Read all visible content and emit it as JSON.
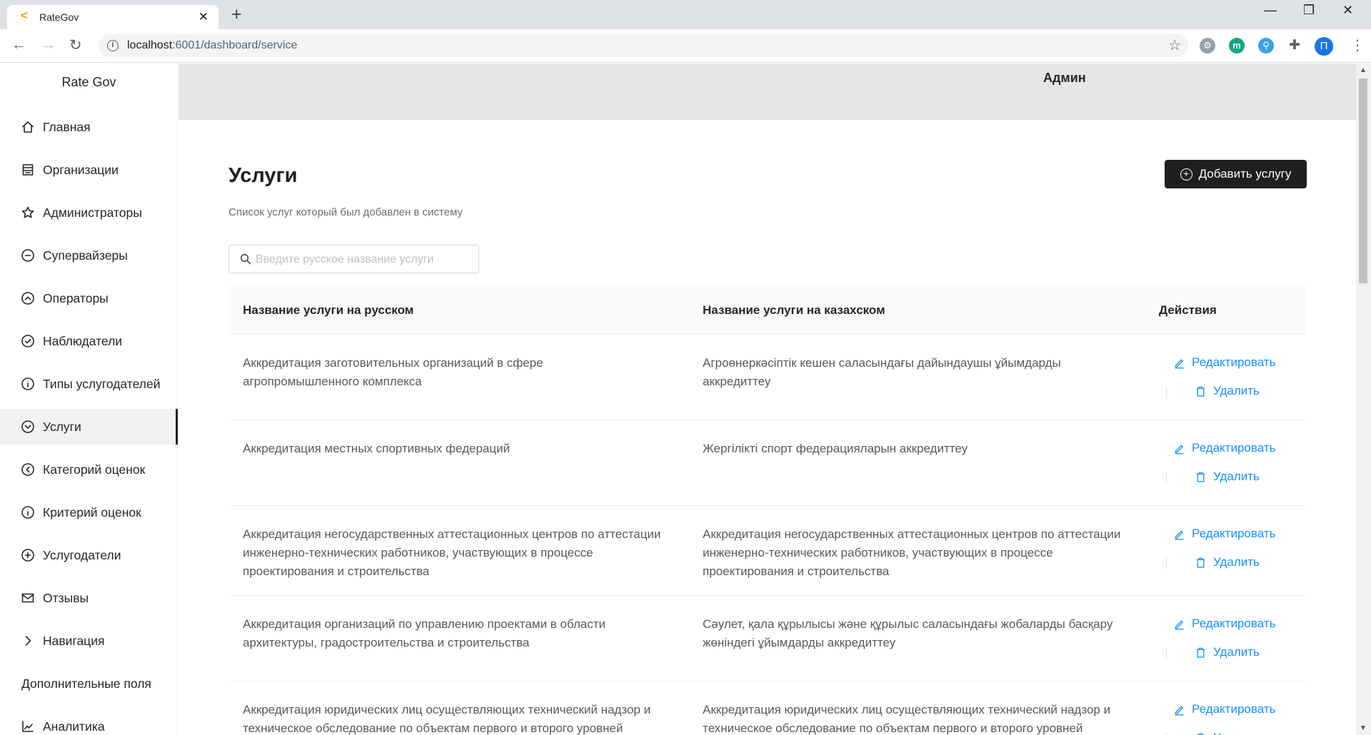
{
  "browser": {
    "tab_title": "RateGov",
    "url_host": "localhost",
    "url_rest": ":6001/dashboard/service",
    "profile_initial": "П"
  },
  "app": {
    "brand": "Rate Gov",
    "admin_label": "Админ"
  },
  "sidebar": {
    "items": [
      {
        "label": "Главная",
        "icon": "home-icon"
      },
      {
        "label": "Организации",
        "icon": "building-icon"
      },
      {
        "label": "Администраторы",
        "icon": "star-icon"
      },
      {
        "label": "Супервайзеры",
        "icon": "minus-circle-icon"
      },
      {
        "label": "Операторы",
        "icon": "up-circle-icon"
      },
      {
        "label": "Наблюдатели",
        "icon": "check-circle-icon"
      },
      {
        "label": "Типы услугодателей",
        "icon": "info-circle-icon"
      },
      {
        "label": "Услуги",
        "icon": "down-circle-icon"
      },
      {
        "label": "Категорий оценок",
        "icon": "left-circle-icon"
      },
      {
        "label": "Критерий оценок",
        "icon": "info-circle-icon"
      },
      {
        "label": "Услугодатели",
        "icon": "plus-circle-icon"
      },
      {
        "label": "Отзывы",
        "icon": "mail-icon"
      },
      {
        "label": "Навигация",
        "icon": "chevron-right-icon"
      },
      {
        "label": "Дополнительные поля",
        "icon": ""
      },
      {
        "label": "Аналитика",
        "icon": "line-chart-icon"
      }
    ]
  },
  "main": {
    "title": "Услуги",
    "subtitle": "Список услуг который был добавлен в систему",
    "add_button": "Добавить услугу",
    "search_placeholder": "Введите русское название услуги",
    "table": {
      "headers": [
        "Название услуги на русском",
        "Название услуги на казахском",
        "Действия"
      ],
      "edit_label": "Редактировать",
      "delete_label": "Удалить",
      "rows": [
        {
          "ru": [
            "Аккредитация заготовительных организаций в сфере",
            "агропромышленного комплекса"
          ],
          "kz": [
            "Агроөнеркәсіптік кешен саласындағы дайындаушы ұйымдарды",
            "аккредиттеу"
          ]
        },
        {
          "ru": [
            "Аккредитация местных спортивных федераций"
          ],
          "kz": [
            "Жергілікті спорт федерацияларын аккредиттеу"
          ]
        },
        {
          "ru": [
            "Аккредитация негосударственных аттестационных центров по аттестации",
            "инженерно-технических работников, участвующих в процессе",
            "проектирования и строительства"
          ],
          "kz": [
            "Аккредитация негосударственных аттестационных центров по аттестации",
            "инженерно-технических работников, участвующих в процессе",
            "проектирования и строительства"
          ]
        },
        {
          "ru": [
            "Аккредитация организаций по управлению проектами в области",
            "архитектуры, градостроительства и строительства"
          ],
          "kz": [
            "Сәулет, қала құрылысы және құрылыс саласындағы жобаларды басқару",
            "жөніндегі ұйымдарды аккредиттеу"
          ]
        },
        {
          "ru": [
            "Аккредитация юридических лиц осуществляющих технический надзор и",
            "техническое обследование по объектам первого и второго уровней"
          ],
          "kz": [
            "Аккредитация юридических лиц осуществляющих технический надзор и",
            "техническое обследование по объектам первого и второго уровней"
          ]
        }
      ]
    }
  },
  "colors": {
    "link": "#1890ff",
    "primary_button": "#1f1f1f",
    "header_bg": "#e6e6e6"
  }
}
